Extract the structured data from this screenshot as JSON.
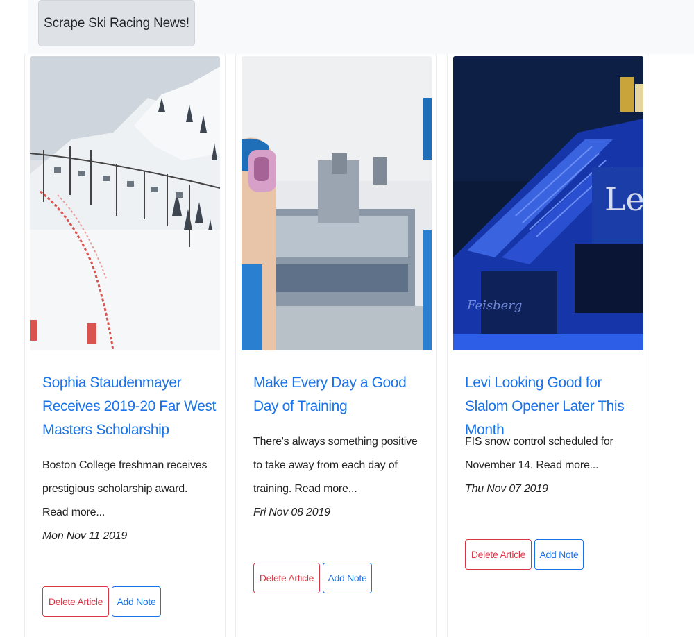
{
  "toolbar": {
    "scrape_label": "Scrape Ski Racing News!"
  },
  "colors": {
    "link": "#1a73e8",
    "danger": "#dc3545",
    "toolbar_bg": "#f8f9fa",
    "button_bg": "#dee2e6"
  },
  "articles": [
    {
      "title": "Sophia Staudenmayer Receives 2019-20 Far West Masters Scholarship",
      "summary": "Boston College freshman receives prestigious scholarship award. Read more...",
      "date": "Mon Nov 11 2019",
      "delete_label": "Delete Article",
      "note_label": "Add Note",
      "image": "snowy ski slope with chairlift and race course"
    },
    {
      "title": "Make Every Day a Good Day of Training",
      "summary": "There's always something positive to take away from each day of training. Read more...",
      "date": "Fri Nov 08 2019",
      "delete_label": "Delete Article",
      "note_label": "Add Note",
      "image": "skier with goggles in front of lodge building"
    },
    {
      "title": "Levi Looking Good for Slalom Opener Later This Month",
      "summary": "FIS snow control scheduled for November 14. Read more...",
      "date": "Thu Nov 07 2019",
      "delete_label": "Delete Article",
      "note_label": "Add Note",
      "image": "Levi ski resort building lit in blue at night"
    }
  ]
}
